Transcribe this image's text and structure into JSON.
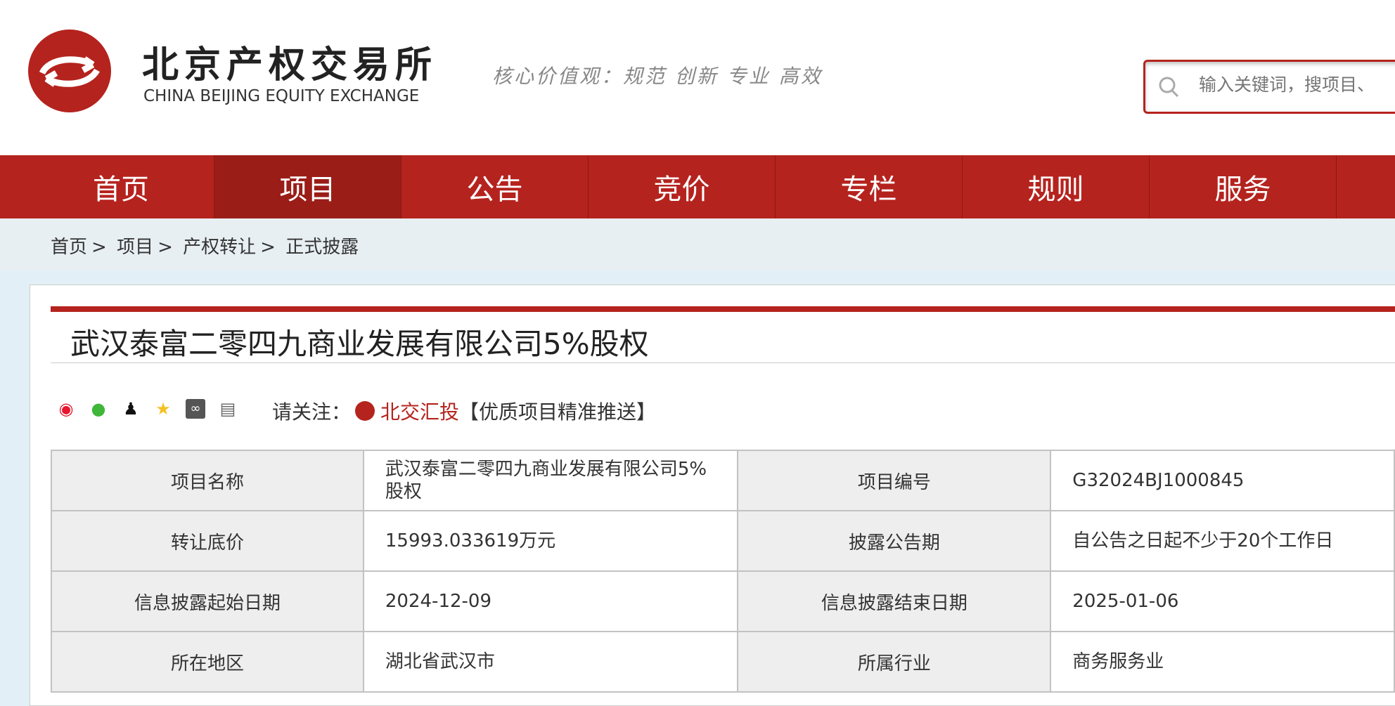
{
  "header": {
    "brand_cn": "北京产权交易所",
    "brand_en": "CHINA BEIJING EQUITY EXCHANGE",
    "slogan": "核心价值观：规范 创新 专业 高效",
    "search_placeholder": "输入关键词，搜项目、"
  },
  "nav": [
    "首页",
    "项目",
    "公告",
    "竞价",
    "专栏",
    "规则",
    "服务"
  ],
  "breadcrumb": [
    "首页",
    "项目",
    "产权转让",
    "正式披露"
  ],
  "breadcrumb_sep": ">",
  "title": "武汉泰富二零四九商业发展有限公司5%股权",
  "share_icons": [
    "weibo-icon",
    "wechat-icon",
    "qq-icon",
    "qzone-icon",
    "link-icon",
    "print-icon"
  ],
  "follow": {
    "label": "请关注：",
    "brand": "北交汇投",
    "tagline": "【优质项目精准推送】"
  },
  "table": [
    [
      {
        "label": "项目名称",
        "value": "武汉泰富二零四九商业发展有限公司5%股权"
      },
      {
        "label": "项目编号",
        "value": "G32024BJ1000845"
      }
    ],
    [
      {
        "label": "转让底价",
        "value": "15993.033619万元"
      },
      {
        "label": "披露公告期",
        "value": "自公告之日起不少于20个工作日"
      }
    ],
    [
      {
        "label": "信息披露起始日期",
        "value": "2024-12-09"
      },
      {
        "label": "信息披露结束日期",
        "value": "2025-01-06"
      }
    ],
    [
      {
        "label": "所在地区",
        "value": "湖北省武汉市"
      },
      {
        "label": "所属行业",
        "value": "商务服务业"
      }
    ]
  ]
}
